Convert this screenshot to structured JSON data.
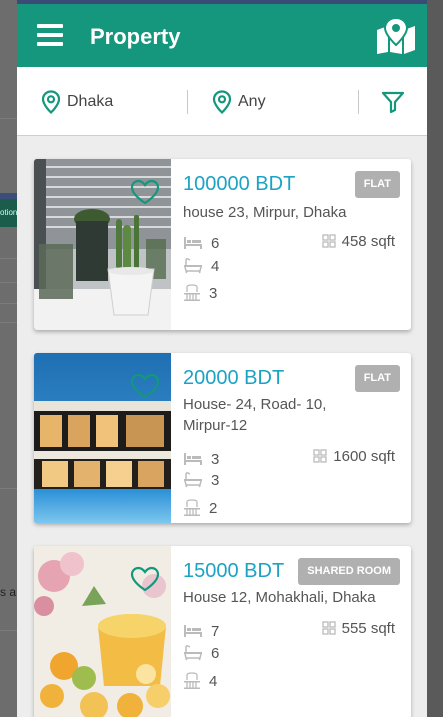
{
  "app": {
    "title": "Property",
    "accent": "#14977c",
    "price_color": "#1ca3c4",
    "menu_icon": "menu-icon",
    "map_icon": "map-icon"
  },
  "filters": {
    "location": "Dhaka",
    "area": "Any",
    "location_icon": "location-pin-icon",
    "filter_icon": "filter-icon"
  },
  "background_fragments": {
    "left_text_1": "otion",
    "left_text_2": "s a"
  },
  "listings": [
    {
      "price": "100000 BDT",
      "type": "FLAT",
      "address": "house 23, Mirpur, Dhaka",
      "bedrooms": "6",
      "bathrooms": "4",
      "balconies": "3",
      "area": "458 sqft",
      "image": "succulent-plants-photo"
    },
    {
      "price": "20000 BDT",
      "type": "FLAT",
      "address": "House- 24, Road- 10, Mirpur-12",
      "bedrooms": "3",
      "bathrooms": "3",
      "balconies": "2",
      "area": "1600 sqft",
      "image": "modern-house-night-photo"
    },
    {
      "price": "15000 BDT",
      "type": "SHARED ROOM",
      "address": "House 12, Mohakhali, Dhaka",
      "bedrooms": "7",
      "bathrooms": "6",
      "balconies": "4",
      "area": "555 sqft",
      "image": "citrus-tea-photo"
    }
  ]
}
